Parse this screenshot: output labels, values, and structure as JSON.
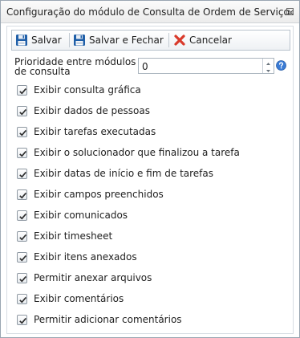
{
  "window": {
    "title": "Configuração do módulo de Consulta de Ordem de Serviço."
  },
  "toolbar": {
    "save_label": "Salvar",
    "save_close_label": "Salvar e Fechar",
    "cancel_label": "Cancelar"
  },
  "priority": {
    "label": "Prioridade entre módulos de consulta",
    "value": "0"
  },
  "options": [
    {
      "label": "Exibir consulta gráfica",
      "checked": true
    },
    {
      "label": "Exibir dados de pessoas",
      "checked": true
    },
    {
      "label": "Exibir tarefas executadas",
      "checked": true
    },
    {
      "label": "Exibir o solucionador que finalizou a tarefa",
      "checked": true
    },
    {
      "label": "Exibir datas de início e fim de tarefas",
      "checked": true
    },
    {
      "label": "Exibir campos preenchidos",
      "checked": true
    },
    {
      "label": "Exibir comunicados",
      "checked": true
    },
    {
      "label": "Exibir timesheet",
      "checked": true
    },
    {
      "label": "Exibir itens anexados",
      "checked": true
    },
    {
      "label": "Permitir anexar arquivos",
      "checked": true
    },
    {
      "label": "Exibir comentários",
      "checked": true
    },
    {
      "label": "Permitir adicionar comentários",
      "checked": true
    }
  ],
  "icons": {
    "save": "floppy-disk-icon",
    "save_close": "floppy-disk-icon",
    "cancel": "red-x-icon",
    "help": "help-icon",
    "close": "close-icon"
  },
  "colors": {
    "accent": "#1f5fa8",
    "cancel_red": "#d93a2b",
    "help_blue": "#3a7bd5"
  }
}
